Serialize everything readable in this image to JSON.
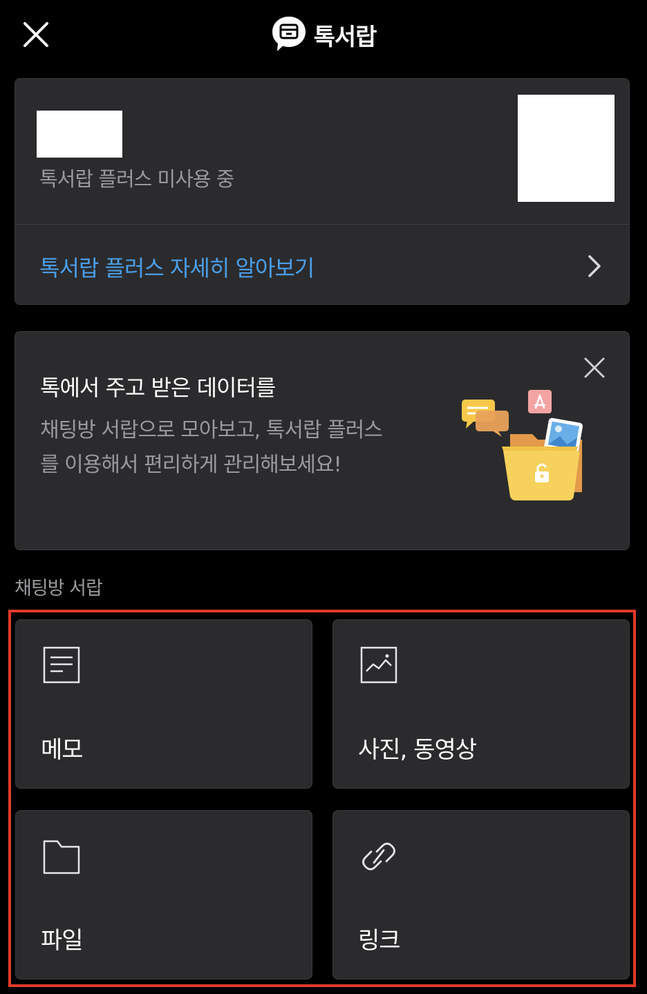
{
  "header": {
    "title": "톡서랍",
    "close_icon": "close-icon",
    "logo_icon": "drawer-chat-icon"
  },
  "account": {
    "status": "톡서랍 플러스 미사용 중",
    "plus_link": "톡서랍 플러스 자세히 알아보기",
    "chevron_icon": "chevron-right-icon"
  },
  "promo": {
    "title": "톡에서 주고 받은 데이터를",
    "body": "채팅방 서랍으로 모아보고, 톡서랍 플러스를 이용해서 편리하게 관리해보세요!",
    "close_icon": "close-icon",
    "illustration_icon": "folder-with-files-illustration"
  },
  "section": {
    "label": "채팅방 서랍"
  },
  "tiles": [
    {
      "label": "메모",
      "icon": "memo-icon"
    },
    {
      "label": "사진, 동영상",
      "icon": "photo-icon"
    },
    {
      "label": "파일",
      "icon": "folder-icon"
    },
    {
      "label": "링크",
      "icon": "link-icon"
    }
  ],
  "colors": {
    "background": "#000000",
    "card": "#2b2b2d",
    "link_blue": "#4a9ee8",
    "highlight_red": "#e23a2a",
    "muted_text": "#9a9a9e"
  }
}
